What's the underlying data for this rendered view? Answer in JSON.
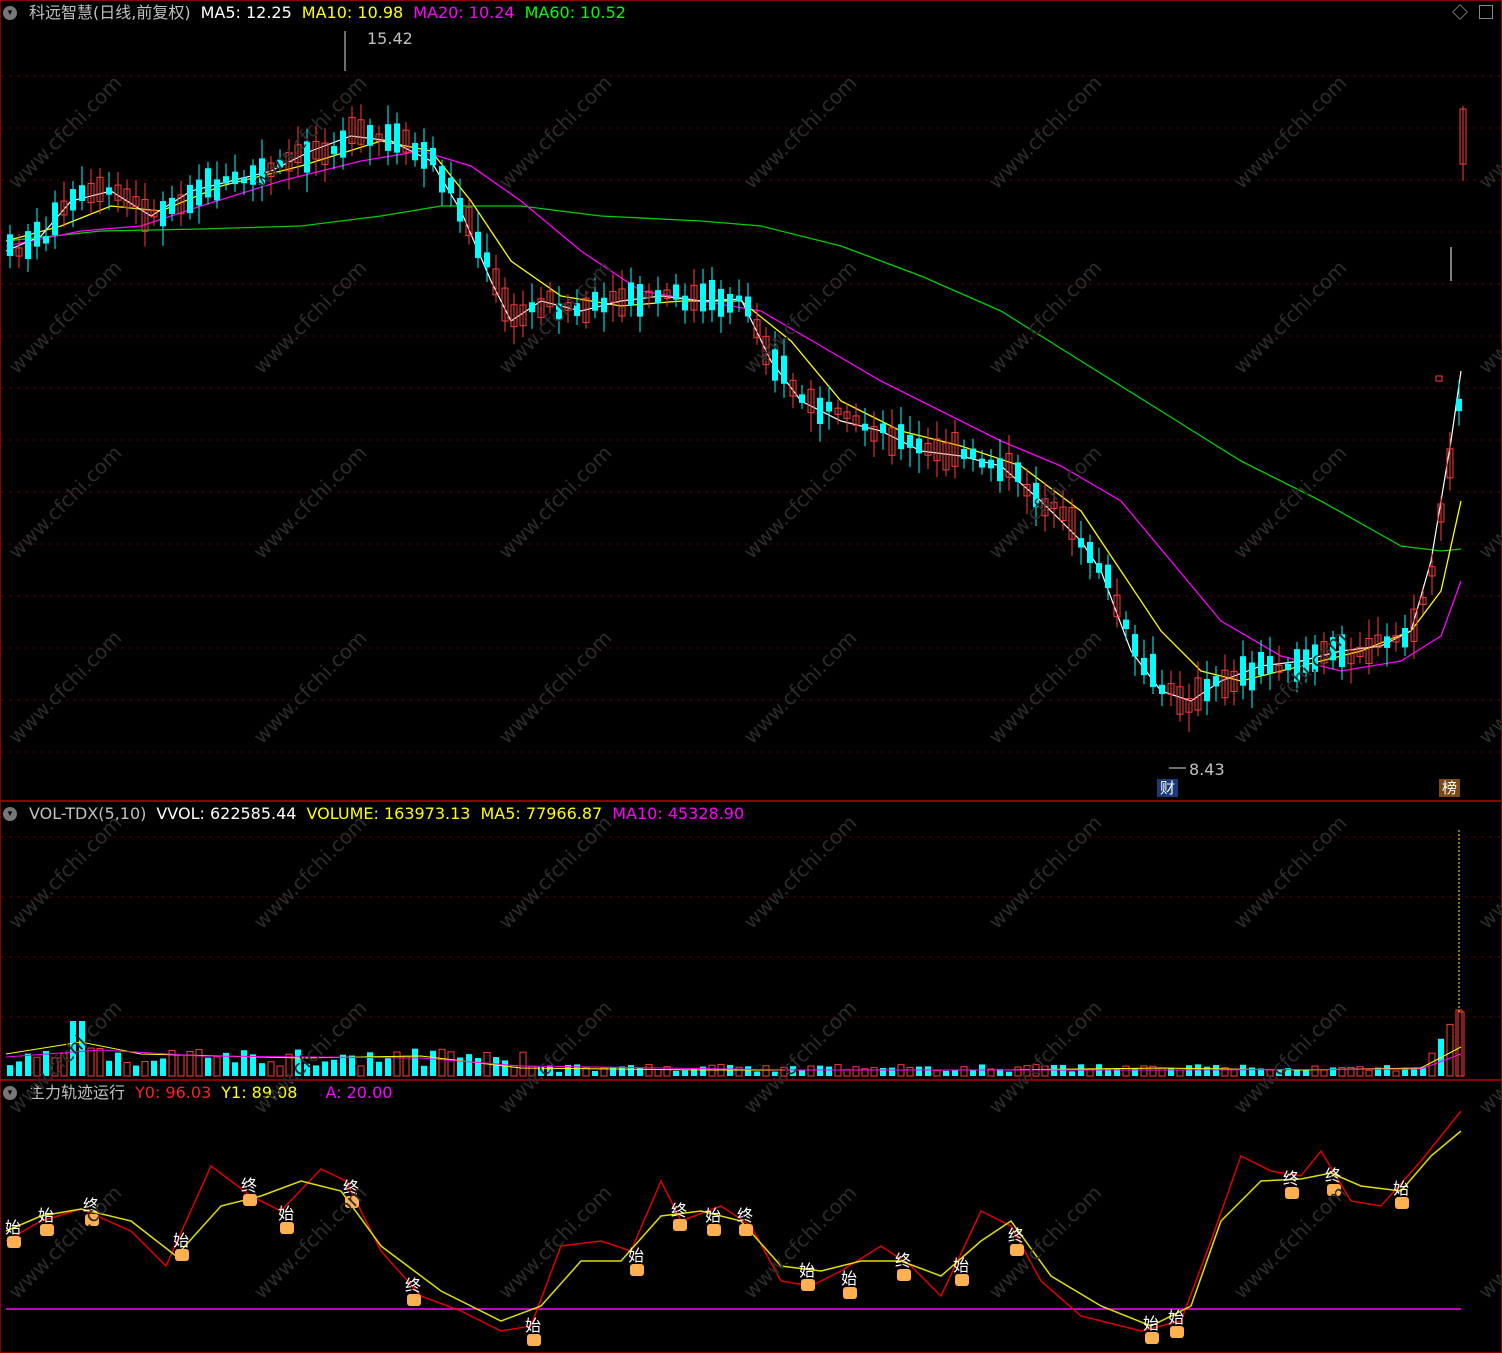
{
  "price_panel": {
    "title": "科远智慧(日线,前复权)",
    "ma5_label": "MA5: 12.25",
    "ma10_label": "MA10: 10.98",
    "ma20_label": "MA20: 10.24",
    "ma60_label": "MA60: 10.52",
    "high_label": "15.42",
    "low_label": "8.43",
    "tag_cai": "财",
    "tag_bang": "榜",
    "colors": {
      "ma5": "#ffffff",
      "ma10": "#ffff00",
      "ma20": "#ff00ff",
      "ma60": "#00ff00",
      "up": "#ff3b3b",
      "down": "#00ffff"
    }
  },
  "volume_panel": {
    "title": "VOL-TDX(5,10)",
    "vvol_label": "VVOL: 622585.44",
    "volume_label": "VOLUME: 163973.13",
    "ma5_label": "MA5: 77966.87",
    "ma10_label": "MA10: 45328.90"
  },
  "indicator_panel": {
    "title": "主力轨迹运行",
    "y0_label": "Y0: 96.03",
    "y1_label": "Y1: 89.08",
    "a_label": "A: 20.00",
    "marker_start": "始",
    "marker_end": "终"
  },
  "watermark": "www.cfchi.com"
}
